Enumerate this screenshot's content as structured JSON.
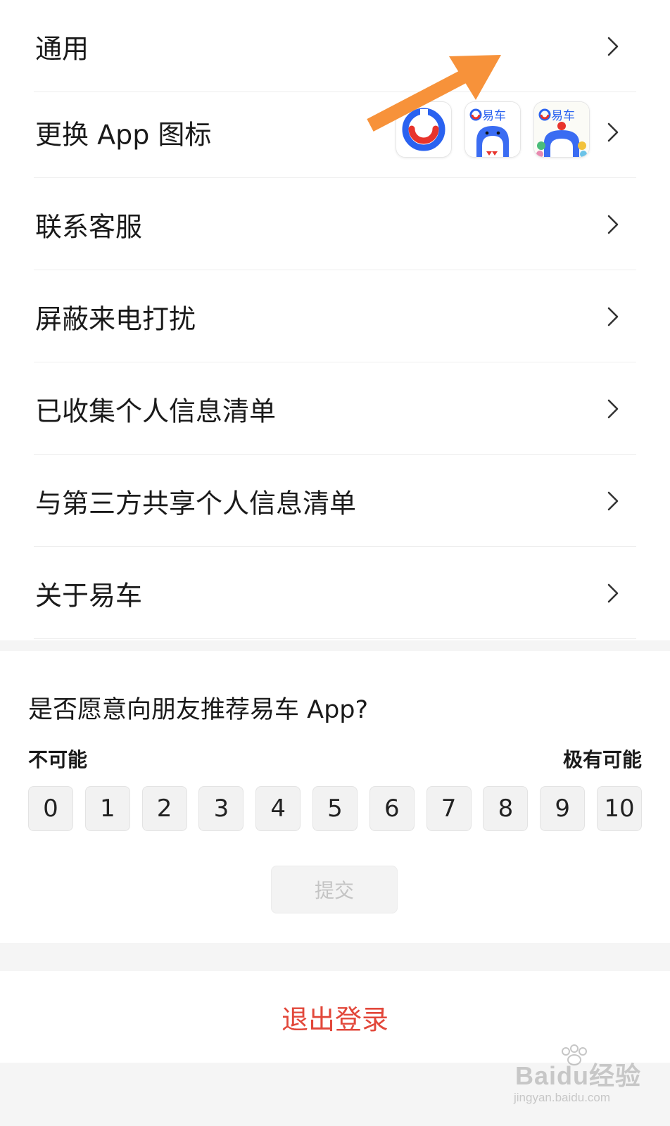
{
  "menu": {
    "items": [
      {
        "label": "通用"
      },
      {
        "label": "更换 App 图标"
      },
      {
        "label": "联系客服"
      },
      {
        "label": "屏蔽来电打扰"
      },
      {
        "label": "已收集个人信息清单"
      },
      {
        "label": "与第三方共享个人信息清单"
      },
      {
        "label": "关于易车"
      }
    ],
    "app_icon_options": [
      {
        "icon": "yiche-logo-icon"
      },
      {
        "icon": "yiche-shark-icon",
        "brand": "易车"
      },
      {
        "icon": "yiche-shark-festival-icon",
        "brand": "易车"
      }
    ]
  },
  "annotation": {
    "icon": "orange-arrow-icon",
    "color": "#f7923a"
  },
  "survey": {
    "question": "是否愿意向朋友推荐易车 App?",
    "scale_low": "不可能",
    "scale_high": "极有可能",
    "scores": [
      "0",
      "1",
      "2",
      "3",
      "4",
      "5",
      "6",
      "7",
      "8",
      "9",
      "10"
    ],
    "submit_label": "提交"
  },
  "logout": {
    "label": "退出登录",
    "color": "#e2473a"
  },
  "watermark": {
    "brand": "Baidu经验",
    "url": "jingyan.baidu.com"
  }
}
